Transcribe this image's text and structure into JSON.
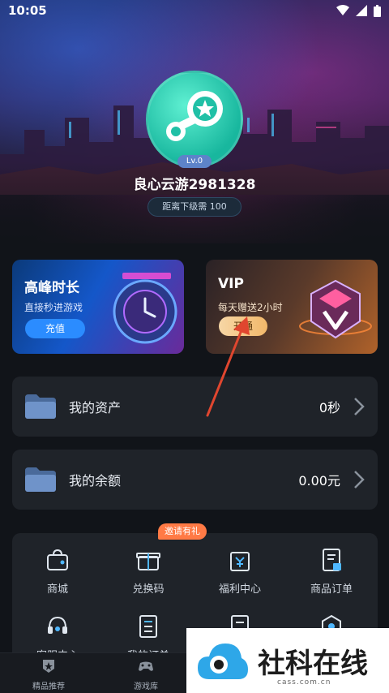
{
  "status_bar": {
    "time": "10:05",
    "icons": [
      "wifi-icon",
      "signal-icon",
      "battery-icon"
    ]
  },
  "profile": {
    "level_badge": "Lv.0",
    "username": "良心云游2981328",
    "next_level_text": "距离下级需 100"
  },
  "promo": {
    "peak": {
      "title": "高峰时长",
      "subtitle": "直接秒进游戏",
      "button": "充值"
    },
    "vip": {
      "title": "VIP",
      "subtitle": "每天赠送2小时",
      "button": "开通"
    }
  },
  "rows": [
    {
      "label": "我的资产",
      "value": "0秒",
      "icon": "folder-icon"
    },
    {
      "label": "我的余额",
      "value": "0.00元",
      "icon": "folder-icon"
    }
  ],
  "grid": {
    "invite_badge": "邀请有礼",
    "items": [
      {
        "label": "商城",
        "icon": "shop-bag-icon"
      },
      {
        "label": "兑换码",
        "icon": "gift-box-icon"
      },
      {
        "label": "福利中心",
        "icon": "welfare-icon"
      },
      {
        "label": "商品订单",
        "icon": "order-doc-icon"
      },
      {
        "label": "客服中心",
        "icon": "headset-icon"
      },
      {
        "label": "我的订单",
        "icon": "list-doc-icon"
      },
      {
        "label": "",
        "icon": "document-icon"
      },
      {
        "label": "",
        "icon": "hexagon-icon"
      }
    ]
  },
  "bottom_nav": [
    {
      "label": "精品推荐",
      "icon": "star-shield-icon"
    },
    {
      "label": "游戏库",
      "icon": "gamepad-icon"
    }
  ],
  "watermark": {
    "text": "社科在线",
    "url": "cass.com.cn"
  },
  "colors": {
    "accent_blue": "#2b8cff",
    "vip_gold": "#f2b86a",
    "card_bg": "#1f2329",
    "invite_orange": "#ff7a45"
  }
}
